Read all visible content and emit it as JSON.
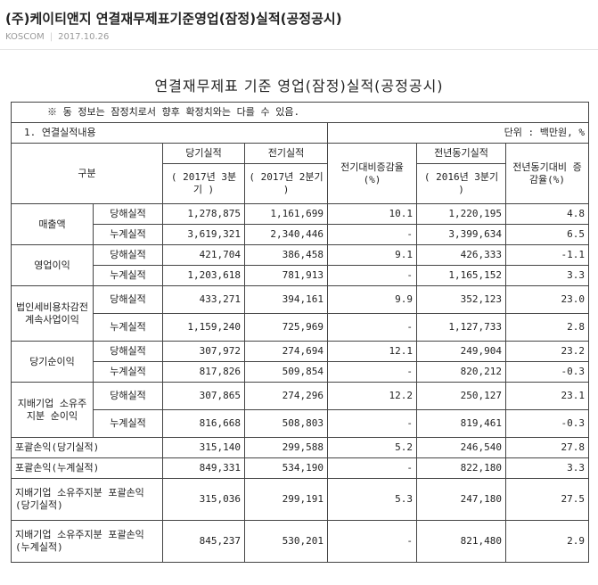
{
  "header": {
    "title": "(주)케이티앤지 연결재무제표기준영업(잠정)실적(공정공시)",
    "source": "KOSCOM",
    "date": "2017.10.26"
  },
  "document": {
    "title": "연결재무제표 기준 영업(잠정)실적(공정공시)",
    "notice": "※ 동 정보는 잠정치로서 향후 확정치와는 다를 수 있음.",
    "section": "1. 연결실적내용",
    "unit": "단위 : 백만원, %"
  },
  "columns": {
    "category": "구분",
    "current": "당기실적",
    "current_period": "( 2017년 3분기 )",
    "previous": "전기실적",
    "previous_period": "( 2017년 2분기 )",
    "qoq": "전기대비증감율 (%)",
    "yoy": "전년동기실적",
    "yoy_period": "( 2016년 3분기 )",
    "yoy_rate": "전년동기대비 증감율(%)"
  },
  "rows": [
    {
      "group": "매출액",
      "sub": "당해실적",
      "cur": "1,278,875",
      "prev": "1,161,699",
      "qoq": "10.1",
      "yoy": "1,220,195",
      "yoy_rate": "4.8"
    },
    {
      "group": "매출액",
      "sub": "누계실적",
      "cur": "3,619,321",
      "prev": "2,340,446",
      "qoq": "-",
      "yoy": "3,399,634",
      "yoy_rate": "6.5"
    },
    {
      "group": "영업이익",
      "sub": "당해실적",
      "cur": "421,704",
      "prev": "386,458",
      "qoq": "9.1",
      "yoy": "426,333",
      "yoy_rate": "-1.1"
    },
    {
      "group": "영업이익",
      "sub": "누계실적",
      "cur": "1,203,618",
      "prev": "781,913",
      "qoq": "-",
      "yoy": "1,165,152",
      "yoy_rate": "3.3"
    },
    {
      "group": "법인세비용차감전계속사업이익",
      "sub": "당해실적",
      "cur": "433,271",
      "prev": "394,161",
      "qoq": "9.9",
      "yoy": "352,123",
      "yoy_rate": "23.0"
    },
    {
      "group": "법인세비용차감전계속사업이익",
      "sub": "누계실적",
      "cur": "1,159,240",
      "prev": "725,969",
      "qoq": "-",
      "yoy": "1,127,733",
      "yoy_rate": "2.8"
    },
    {
      "group": "당기순이익",
      "sub": "당해실적",
      "cur": "307,972",
      "prev": "274,694",
      "qoq": "12.1",
      "yoy": "249,904",
      "yoy_rate": "23.2"
    },
    {
      "group": "당기순이익",
      "sub": "누계실적",
      "cur": "817,826",
      "prev": "509,854",
      "qoq": "-",
      "yoy": "820,212",
      "yoy_rate": "-0.3"
    },
    {
      "group": "지배기업 소유주지분 순이익",
      "sub": "당해실적",
      "cur": "307,865",
      "prev": "274,296",
      "qoq": "12.2",
      "yoy": "250,127",
      "yoy_rate": "23.1"
    },
    {
      "group": "지배기업 소유주지분 순이익",
      "sub": "누계실적",
      "cur": "816,668",
      "prev": "508,803",
      "qoq": "-",
      "yoy": "819,461",
      "yoy_rate": "-0.3"
    },
    {
      "group": "포괄손익(당기실적)",
      "sub": "",
      "cur": "315,140",
      "prev": "299,588",
      "qoq": "5.2",
      "yoy": "246,540",
      "yoy_rate": "27.8"
    },
    {
      "group": "포괄손익(누계실적)",
      "sub": "",
      "cur": "849,331",
      "prev": "534,190",
      "qoq": "-",
      "yoy": "822,180",
      "yoy_rate": "3.3"
    },
    {
      "group": "지배기업 소유주지분 포괄손익(당기실적)",
      "sub": "",
      "cur": "315,036",
      "prev": "299,191",
      "qoq": "5.3",
      "yoy": "247,180",
      "yoy_rate": "27.5"
    },
    {
      "group": "지배기업 소유주지분 포괄손익(누계실적)",
      "sub": "",
      "cur": "845,237",
      "prev": "530,201",
      "qoq": "-",
      "yoy": "821,480",
      "yoy_rate": "2.9"
    }
  ]
}
